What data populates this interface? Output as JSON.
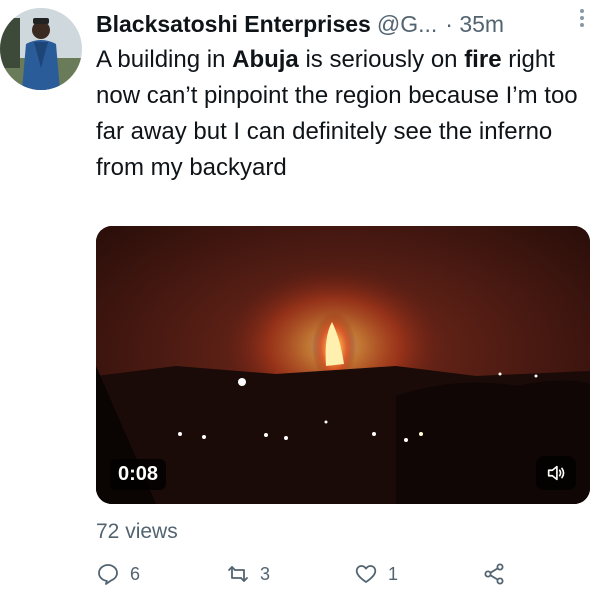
{
  "tweet": {
    "author_name": "Blacksatoshi Enterprises",
    "handle": "@G...",
    "time": "· 35m",
    "text_parts": {
      "p1": "A building in ",
      "p2": "Abuja",
      "p3": " is seriously on ",
      "p4": "fire",
      "p5": " right now can’t pinpoint the region because I’m too far away but I can definitely see the inferno from my backyard"
    },
    "video": {
      "duration": "0:08"
    },
    "views": "72 views",
    "actions": {
      "reply_count": "6",
      "retweet_count": "3",
      "like_count": "1"
    }
  },
  "icons": {
    "more": "more-vertical-icon",
    "mute": "speaker-icon",
    "reply": "reply-icon",
    "retweet": "retweet-icon",
    "like": "heart-icon",
    "share": "share-icon"
  }
}
